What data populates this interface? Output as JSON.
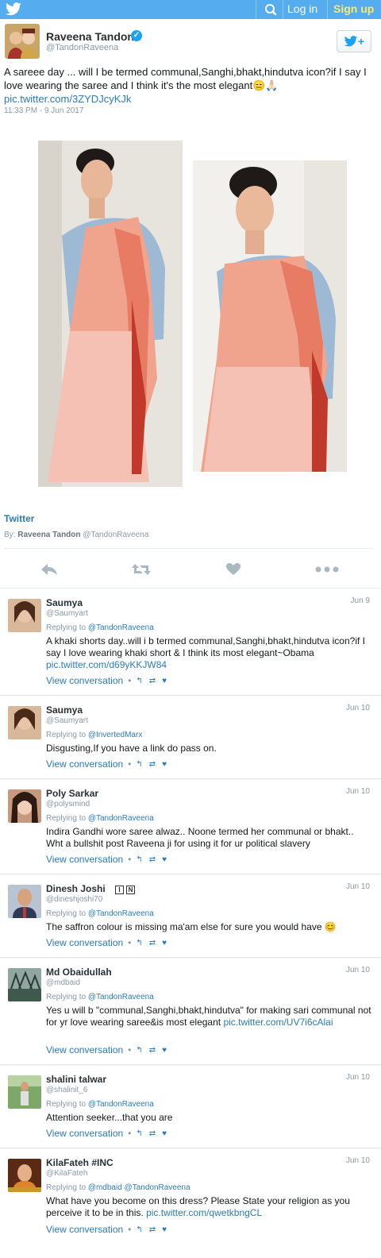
{
  "topbar": {
    "login": "Log in",
    "signup": "Sign up",
    "bird_icon": "twitter-bird-icon",
    "search_icon": "search-icon"
  },
  "tweet": {
    "author_name": "Raveena Tandon",
    "author_handle": "@TandonRaveena",
    "follow_label": "+",
    "text": "A sareee day ... will I be termed communal,Sanghi,bhakt,hindutva icon?if I say I love wearing the saree and I think it's the most elegant😑🙏🏻",
    "link": "pic.twitter.com/3ZYDJcyKJk",
    "time": "11:33 PM - 9 Jun 2017",
    "card_source": "Twitter",
    "card_by_prefix": "By:",
    "card_by_name": "Raveena Tandon",
    "card_by_handle": "@TandonRaveena"
  },
  "replies": [
    {
      "name": "Saumya",
      "handle": "@Saumyart",
      "date": "Jun 9",
      "replying_prefix": "Replying to",
      "replying_to": "@TandonRaveena",
      "text": "A khaki shorts day..will i b termed communal,Sanghi,bhakt,hindutva icon?if I say I love wearing khaki short & I think its most elegant~Obama",
      "link": "pic.twitter.com/d69yKKJW84",
      "view": "View conversation"
    },
    {
      "name": "Saumya",
      "handle": "@Saumyart",
      "date": "Jun 10",
      "replying_prefix": "Replying to",
      "replying_to": "@InvertedMarx",
      "text": "Disgusting,If you have a link do pass on.",
      "link": "",
      "view": "View conversation"
    },
    {
      "name": "Poly Sarkar",
      "handle": "@polysmind",
      "date": "Jun 10",
      "replying_prefix": "Replying to",
      "replying_to": "@TandonRaveena",
      "text": "Indira Gandhi wore saree alwaz.. Noone termed her communal or bhakt.. Wht a bullshit post Raveena ji for using it for ur political slavery",
      "link": "",
      "view": "View conversation"
    },
    {
      "name": "Dinesh Joshi",
      "handle": "@dineshjoshi70",
      "date": "Jun 10",
      "replying_prefix": "Replying to",
      "replying_to": "@TandonRaveena",
      "text": "The saffron colour is missing ma'am else for sure you would have 😊",
      "link": "",
      "view": "View conversation"
    },
    {
      "name": "Md Obaidullah",
      "handle": "@mdbaid",
      "date": "Jun 10",
      "replying_prefix": "Replying to",
      "replying_to": "@TandonRaveena",
      "text": "Yes u will b \"communal,Sanghi,bhakt,hindutva\" for making sari communal not for yr love wearing saree&is most elegant",
      "link": "pic.twitter.com/UV7i6cAlai",
      "view": "View conversation"
    },
    {
      "name": "shalini talwar",
      "handle": "@shalinit_6",
      "date": "Jun 10",
      "replying_prefix": "Replying to",
      "replying_to": "@TandonRaveena",
      "text": "Attention seeker...that you are",
      "link": "",
      "view": "View conversation"
    },
    {
      "name": "KilaFateh #INC",
      "handle": "@KilaFateh",
      "date": "Jun 10",
      "replying_prefix": "Replying to",
      "replying_to": "@mdbaid @TandonRaveena",
      "text": "What have you become on this dress? Please State your religion as you perceive it to be in this.",
      "link": "pic.twitter.com/qwetkbngCL",
      "view": "View conversation"
    }
  ],
  "colors": {
    "accent": "#55acee",
    "link": "#2b7bb9",
    "signup": "#ffe866"
  }
}
